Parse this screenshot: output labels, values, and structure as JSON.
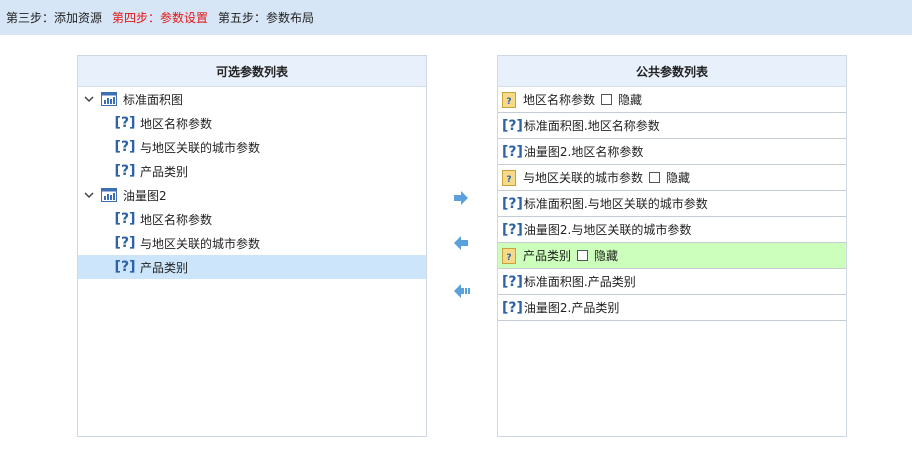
{
  "steps": [
    {
      "label": "第三步：添加资源",
      "active": false
    },
    {
      "label": "第四步：参数设置",
      "active": true
    },
    {
      "label": "第五步：参数布局",
      "active": false
    }
  ],
  "colors": {
    "accent": "#e61515",
    "header_bg": "#d6e6f6",
    "selected_row": "#cde5fb",
    "highlight_row": "#ccffbb",
    "icon_blue": "#2d62a6",
    "arrow_blue": "#5aa0dc"
  },
  "left_panel": {
    "title": "可选参数列表",
    "tree": [
      {
        "label": "标准面积图",
        "icon": "chart-icon",
        "children": [
          "地区名称参数",
          "与地区关联的城市参数",
          "产品类别"
        ]
      },
      {
        "label": "油量图2",
        "icon": "chart-icon",
        "children": [
          "地区名称参数",
          "与地区关联的城市参数",
          "产品类别"
        ]
      }
    ],
    "selected": "油量图2.产品类别"
  },
  "right_panel": {
    "title": "公共参数列表",
    "hide_label": "隐藏",
    "rows": [
      {
        "type": "group",
        "label": "地区名称参数",
        "hidden": false
      },
      {
        "type": "item",
        "label": "标准面积图.地区名称参数"
      },
      {
        "type": "item",
        "label": "油量图2.地区名称参数"
      },
      {
        "type": "group",
        "label": "与地区关联的城市参数",
        "hidden": false
      },
      {
        "type": "item",
        "label": "标准面积图.与地区关联的城市参数"
      },
      {
        "type": "item",
        "label": "油量图2.与地区关联的城市参数"
      },
      {
        "type": "group",
        "label": "产品类别",
        "hidden": false,
        "highlighted": true
      },
      {
        "type": "item",
        "label": "标准面积图.产品类别"
      },
      {
        "type": "item",
        "label": "油量图2.产品类别"
      }
    ]
  },
  "arrow_buttons": [
    "move-right-arrow-icon",
    "move-left-arrow-icon",
    "move-all-left-arrow-icon"
  ]
}
